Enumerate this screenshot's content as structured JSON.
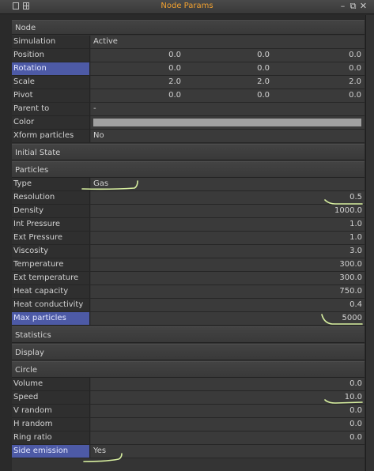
{
  "window": {
    "title": "Node Params"
  },
  "sections": {
    "node": "Node",
    "initial_state": "Initial State",
    "particles": "Particles",
    "statistics": "Statistics",
    "display": "Display",
    "circle": "Circle"
  },
  "node": {
    "simulation": {
      "label": "Simulation",
      "value": "Active"
    },
    "position": {
      "label": "Position",
      "x": "0.0",
      "y": "0.0",
      "z": "0.0"
    },
    "rotation": {
      "label": "Rotation",
      "x": "0.0",
      "y": "0.0",
      "z": "0.0"
    },
    "scale": {
      "label": "Scale",
      "x": "2.0",
      "y": "2.0",
      "z": "2.0"
    },
    "pivot": {
      "label": "Pivot",
      "x": "0.0",
      "y": "0.0",
      "z": "0.0"
    },
    "parent_to": {
      "label": "Parent to",
      "value": "-"
    },
    "color": {
      "label": "Color",
      "swatch": "#a0a0a0"
    },
    "xform_particles": {
      "label": "Xform particles",
      "value": "No"
    }
  },
  "particles": {
    "type": {
      "label": "Type",
      "value": "Gas"
    },
    "resolution": {
      "label": "Resolution",
      "value": "0.5"
    },
    "density": {
      "label": "Density",
      "value": "1000.0"
    },
    "int_pressure": {
      "label": "Int Pressure",
      "value": "1.0"
    },
    "ext_pressure": {
      "label": "Ext Pressure",
      "value": "1.0"
    },
    "viscosity": {
      "label": "Viscosity",
      "value": "3.0"
    },
    "temperature": {
      "label": "Temperature",
      "value": "300.0"
    },
    "ext_temperature": {
      "label": "Ext temperature",
      "value": "300.0"
    },
    "heat_capacity": {
      "label": "Heat capacity",
      "value": "750.0"
    },
    "heat_conductivity": {
      "label": "Heat conductivity",
      "value": "0.4"
    },
    "max_particles": {
      "label": "Max particles",
      "value": "5000"
    }
  },
  "circle": {
    "volume": {
      "label": "Volume",
      "value": "0.0"
    },
    "speed": {
      "label": "Speed",
      "value": "10.0"
    },
    "v_random": {
      "label": "V random",
      "value": "0.0"
    },
    "h_random": {
      "label": "H random",
      "value": "0.0"
    },
    "ring_ratio": {
      "label": "Ring ratio",
      "value": "0.0"
    },
    "side_emission": {
      "label": "Side emission",
      "value": "Yes"
    }
  },
  "colors": {
    "accent_title": "#f0a030",
    "selected_label": "#4d5aa6",
    "annotation_mark": "#d8f0a0"
  }
}
